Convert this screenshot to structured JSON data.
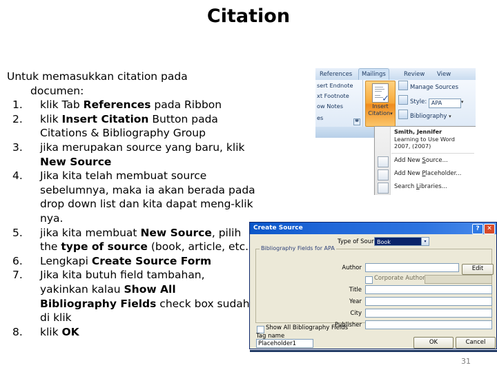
{
  "slide": {
    "title": "Citation",
    "page_number": "31"
  },
  "body": {
    "intro_line1": "Untuk memasukkan citation pada",
    "intro_line2": "documen:",
    "steps": [
      {
        "num": "1.",
        "html": "klik Tab <b>References</b> pada Ribbon"
      },
      {
        "num": "2.",
        "html": "klik  <b>Insert Citation</b> Button pada Citations &amp; Bibliography Group"
      },
      {
        "num": "3.",
        "html": "jika merupakan source yang baru, klik <b>New Source</b>"
      },
      {
        "num": "4.",
        "html": "Jika kita telah membuat source sebelumnya, maka ia akan berada pada drop down list dan kita dapat meng-klik nya."
      },
      {
        "num": "5.",
        "html": "jika kita membuat <b>New Source</b>, pilih the <b>type of source</b> (book, article, etc.)"
      },
      {
        "num": "6.",
        "html": "Lengkapi <b>Create Source Form</b>"
      },
      {
        "num": "7.",
        "html": "Jika kita butuh field tambahan, yakinkan kalau  <b>Show All Bibliography Fields</b> check box sudah di klik"
      },
      {
        "num": "8.",
        "html": "klik <b>OK</b>"
      }
    ]
  },
  "ribbon": {
    "tabs": [
      {
        "label": "References",
        "active": false
      },
      {
        "label": "Mailings",
        "active": true
      },
      {
        "label": "Review",
        "active": false
      },
      {
        "label": "View",
        "active": false
      }
    ],
    "footnotes_group": {
      "line1": "sert Endnote",
      "line2": "xt Footnote",
      "line3": "ow Notes",
      "line4": "es",
      "launcher_icon": "dialog-launcher-icon"
    },
    "insert_citation": {
      "label_line1": "Insert",
      "label_line2": "Citation",
      "caret": "▾",
      "icon": "insert-citation-icon"
    },
    "citations_group": {
      "manage_sources": "Manage Sources",
      "style_label": "Style:",
      "style_value": "APA",
      "bibliography": "Bibliography",
      "caret": "▾"
    }
  },
  "citation_menu": {
    "source_author": "Smith, Jennifer",
    "source_title": "Learning to Use Word",
    "source_year": "2007, (2007)",
    "items": [
      {
        "label_pre": "Add New ",
        "label_key": "S",
        "label_post": "ource...",
        "icon": "add-new-source-icon"
      },
      {
        "label_pre": "Add New ",
        "label_key": "P",
        "label_post": "laceholder...",
        "icon": "add-new-placeholder-icon"
      },
      {
        "label_pre": "Search ",
        "label_key": "L",
        "label_post": "ibraries...",
        "icon": "search-libraries-icon"
      }
    ]
  },
  "create_source": {
    "title": "Create Source",
    "help_button": "?",
    "close_button": "✕",
    "type_of_source_label": "Type of Source",
    "type_of_source_value": "Book",
    "dropdown_arrow": "▾",
    "group_label": "Bibliography Fields for APA",
    "fields": [
      {
        "label": "Author",
        "value": ""
      },
      {
        "label": "Title",
        "value": ""
      },
      {
        "label": "Year",
        "value": ""
      },
      {
        "label": "City",
        "value": ""
      },
      {
        "label": "Publisher",
        "value": ""
      }
    ],
    "edit_button": "Edit",
    "corporate_author_label": "Corporate Author",
    "show_all_label": "Show All Bibliography Fields",
    "tag_name_label": "Tag name",
    "tag_name_value": "Placeholder1",
    "ok_button": "OK",
    "cancel_button": "Cancel"
  },
  "colors": {
    "title_bar_blue": "#0a56c8",
    "dialog_face": "#ece9d8",
    "ribbon_highlight": "#f7a93a",
    "footer_rule": "#1f3864"
  }
}
